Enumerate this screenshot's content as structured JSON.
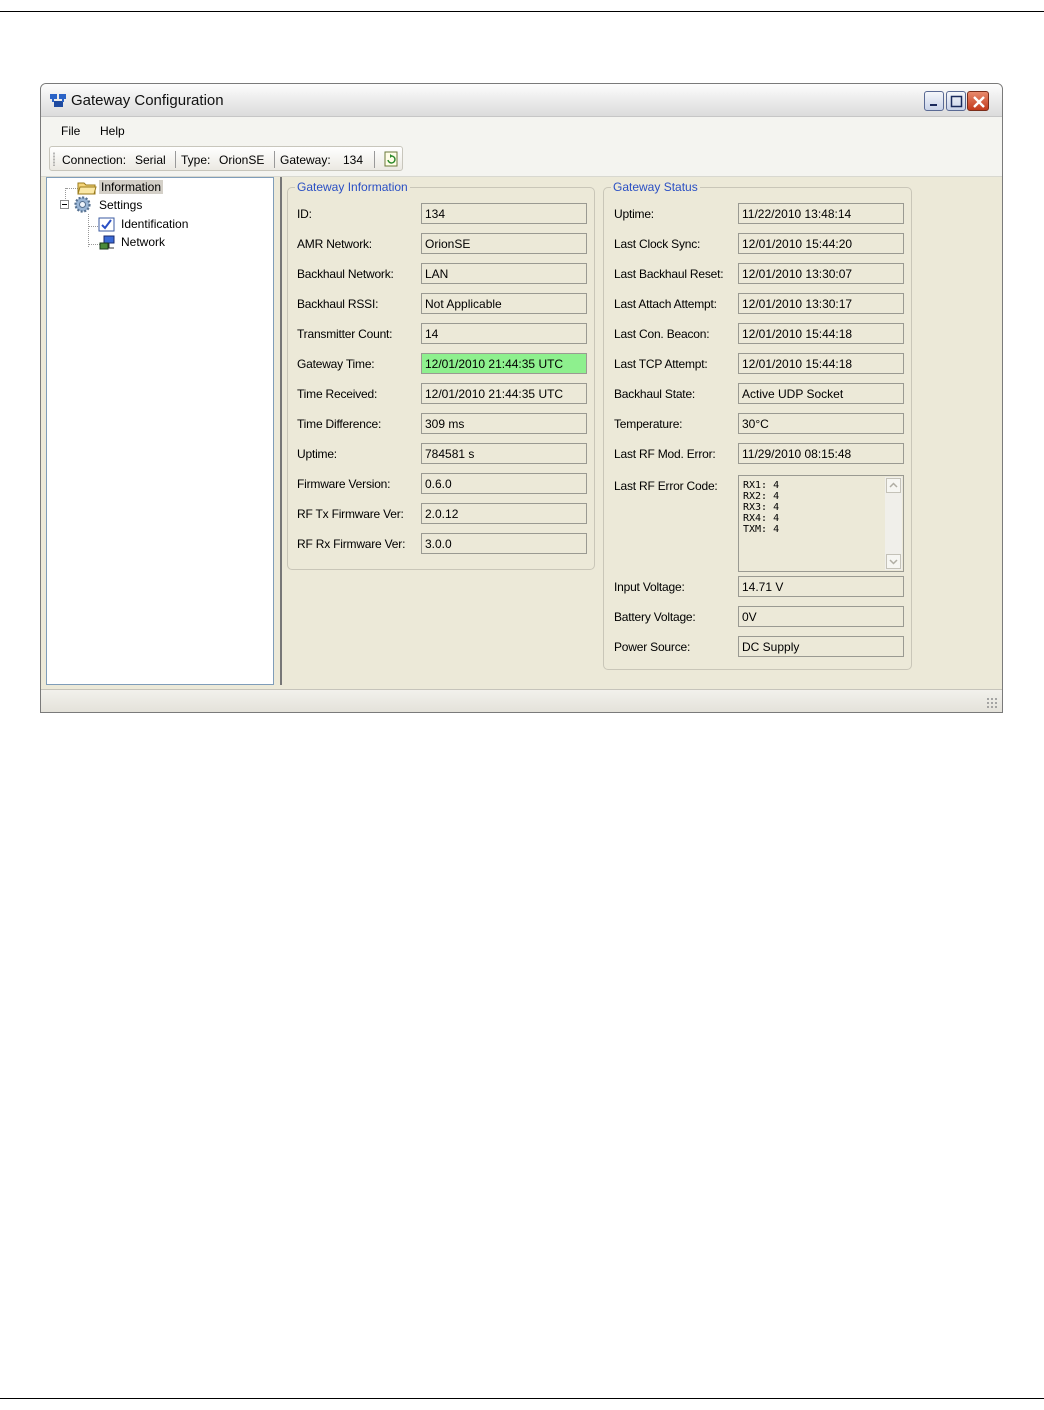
{
  "window": {
    "title": "Gateway Configuration"
  },
  "menu": [
    "File",
    "Help"
  ],
  "toolbar": {
    "connection_label": "Connection:",
    "connection_value": "Serial",
    "type_label": "Type:",
    "type_value": "OrionSE",
    "gateway_label": "Gateway:",
    "gateway_value": "134",
    "refresh_icon": "refresh-icon"
  },
  "tree": {
    "information": "Information",
    "settings": "Settings",
    "identification": "Identification",
    "network": "Network",
    "selected": "Information"
  },
  "gateway_info": {
    "title": "Gateway Information",
    "rows": [
      {
        "label": "ID:",
        "value": "134"
      },
      {
        "label": "AMR Network:",
        "value": "OrionSE"
      },
      {
        "label": "Backhaul Network:",
        "value": "LAN"
      },
      {
        "label": "Backhaul RSSI:",
        "value": "Not Applicable"
      },
      {
        "label": "Transmitter Count:",
        "value": "14"
      },
      {
        "label": "Gateway Time:",
        "value": "12/01/2010 21:44:35 UTC"
      },
      {
        "label": "Time Received:",
        "value": "12/01/2010 21:44:35 UTC"
      },
      {
        "label": "Time Difference:",
        "value": "309 ms"
      },
      {
        "label": "Uptime:",
        "value": "784581 s"
      },
      {
        "label": "Firmware Version:",
        "value": "0.6.0"
      },
      {
        "label": "RF Tx Firmware Ver:",
        "value": "2.0.12"
      },
      {
        "label": "RF Rx Firmware Ver:",
        "value": "3.0.0"
      }
    ],
    "highlight_color": "#8ef08e"
  },
  "gateway_status": {
    "title": "Gateway Status",
    "rows": [
      {
        "label": "Uptime:",
        "value": "11/22/2010 13:48:14"
      },
      {
        "label": "Last Clock Sync:",
        "value": "12/01/2010 15:44:20"
      },
      {
        "label": "Last Backhaul Reset:",
        "value": "12/01/2010 13:30:07"
      },
      {
        "label": "Last Attach Attempt:",
        "value": "12/01/2010 13:30:17"
      },
      {
        "label": "Last Con. Beacon:",
        "value": "12/01/2010 15:44:18"
      },
      {
        "label": "Last TCP Attempt:",
        "value": "12/01/2010 15:44:18"
      },
      {
        "label": "Backhaul State:",
        "value": "Active UDP Socket"
      },
      {
        "label": "Temperature:",
        "value": "30°C"
      },
      {
        "label": "Last RF Mod. Error:",
        "value": "11/29/2010 08:15:48"
      }
    ],
    "error_code": {
      "label": "Last RF Error Code:",
      "lines": [
        "RX1: 4",
        "RX2: 4",
        "RX3: 4",
        "RX4: 4",
        "TXM: 4"
      ]
    },
    "power_rows": [
      {
        "label": "Input Voltage:",
        "value": "14.71 V"
      },
      {
        "label": "Battery Voltage:",
        "value": "0V"
      },
      {
        "label": "Power Source:",
        "value": "DC Supply"
      }
    ]
  }
}
